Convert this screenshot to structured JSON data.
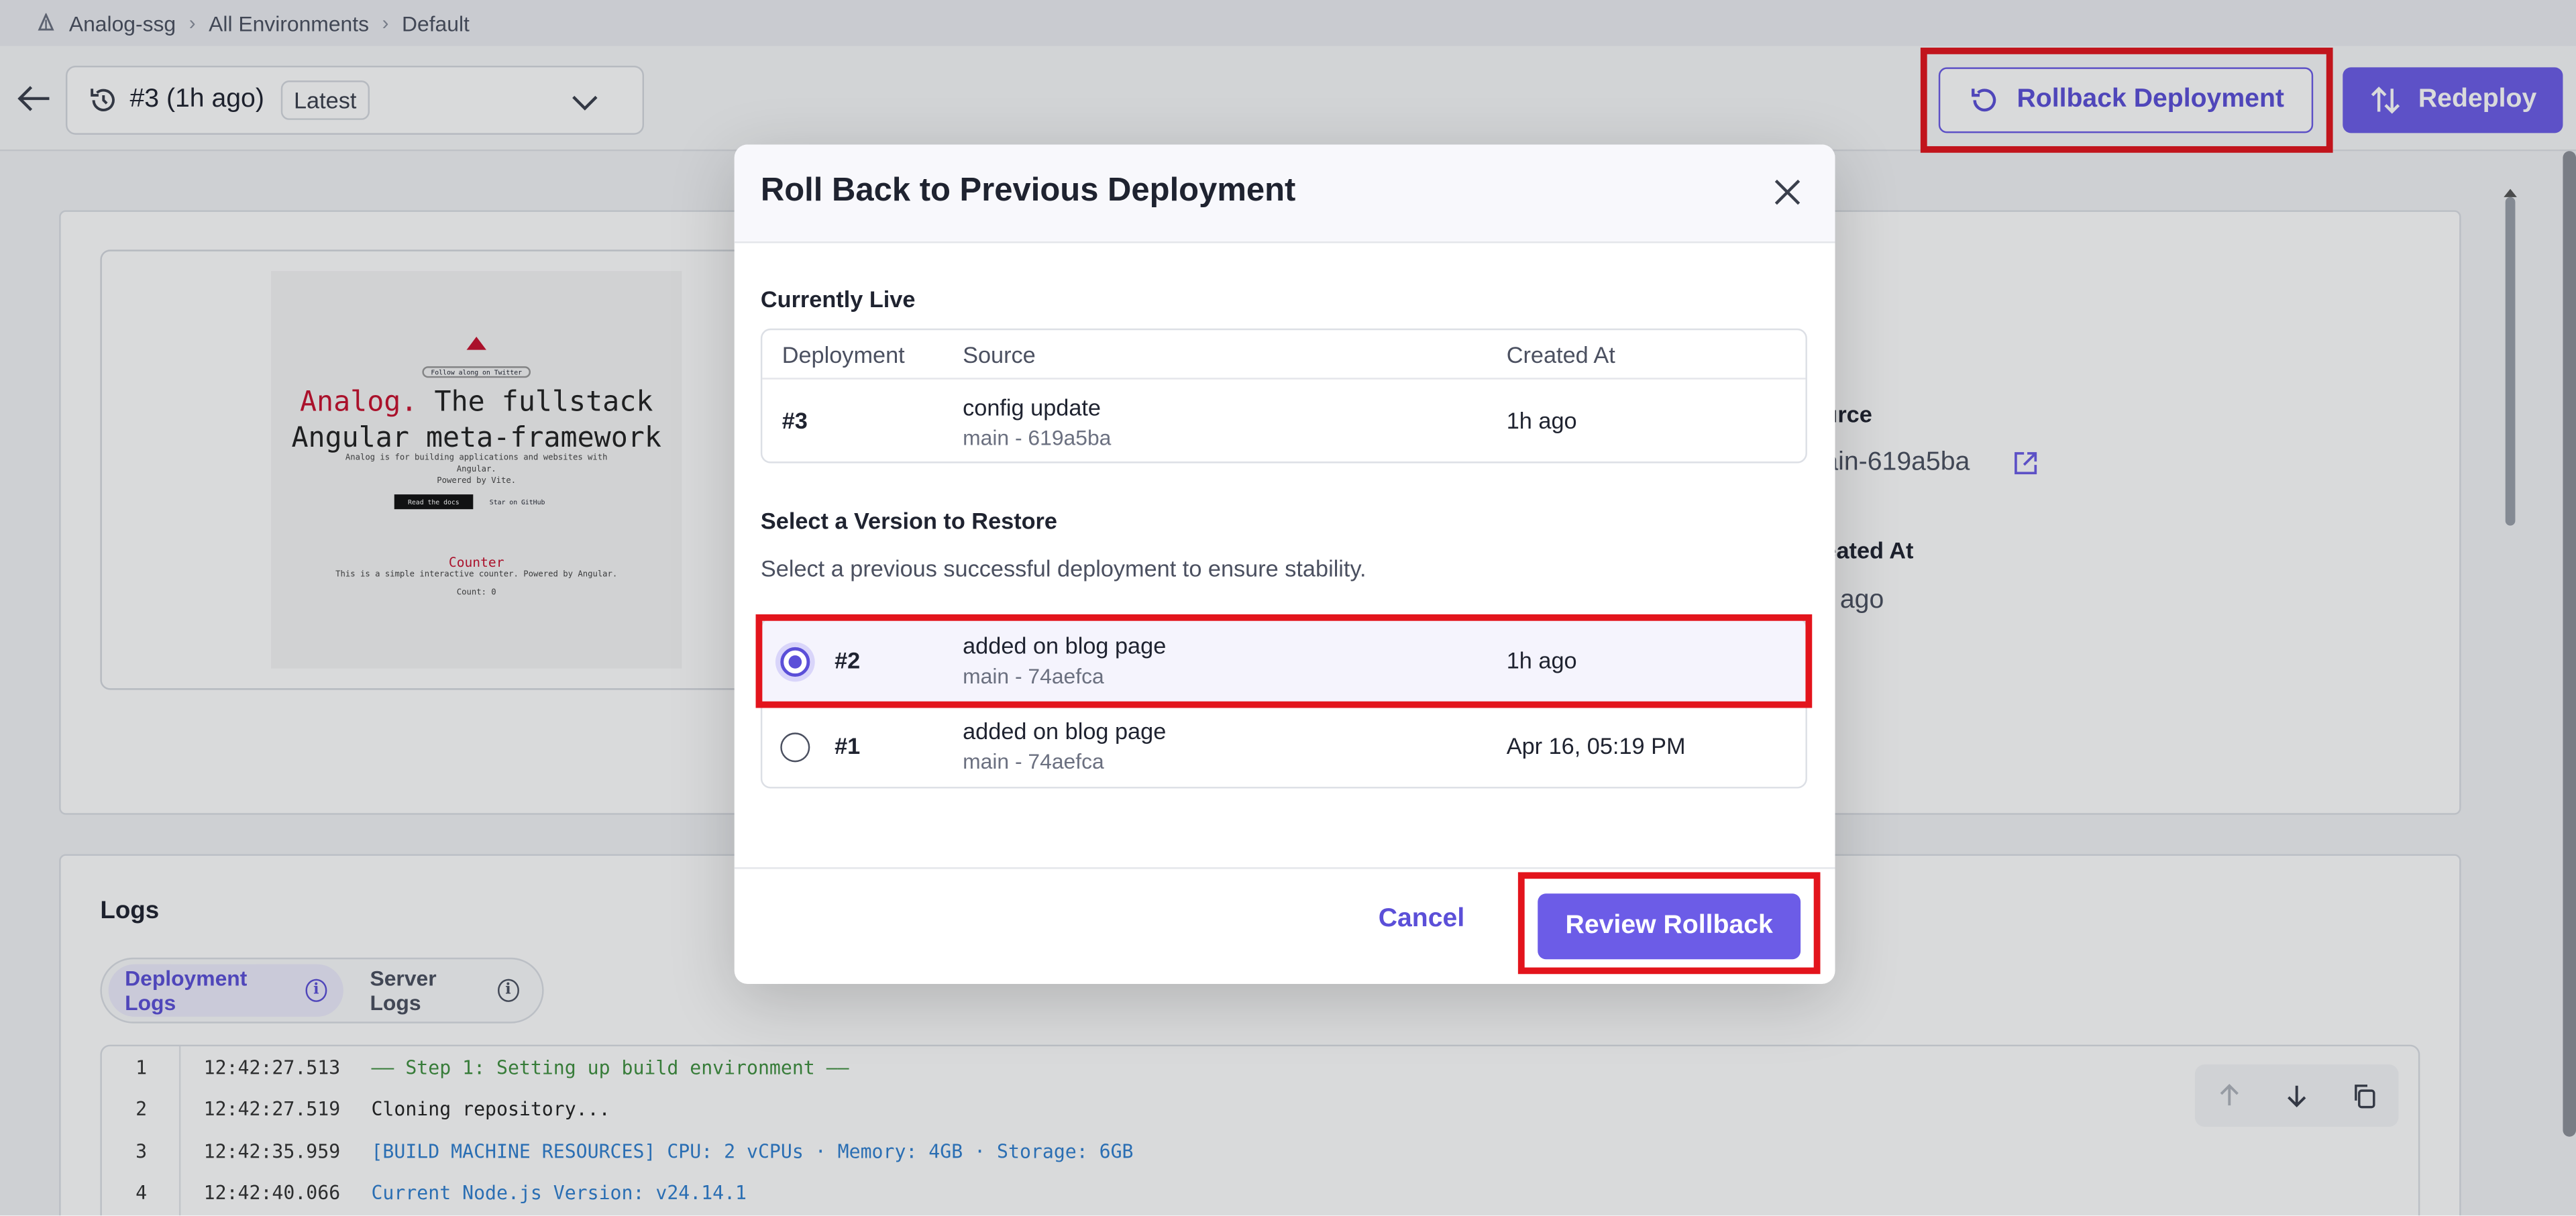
{
  "breadcrumb": {
    "items": [
      "Analog-ssg",
      "All Environments",
      "Default"
    ]
  },
  "header": {
    "deployment_label": "#3 (1h ago)",
    "deployment_badge": "Latest",
    "rollback_label": "Rollback Deployment",
    "redeploy_label": "Redeploy"
  },
  "preview": {
    "pill": "Follow along on Twitter",
    "heading_red": "Analog.",
    "heading_rest": " The fullstack",
    "heading_line2": "Angular meta-framework",
    "desc1": "Analog is for building applications and websites with",
    "desc2": "Angular.",
    "desc3": "Powered by Vite.",
    "btn_primary": "Read the docs",
    "btn_secondary": "Star on GitHub",
    "counter_title": "Counter",
    "counter_desc": "This is a simple interactive counter. Powered by Angular.",
    "counter_value": "Count: 0"
  },
  "details": {
    "source_label": "urce",
    "source_value": "ain-619a5ba",
    "created_label": "eated At",
    "created_value": "ago"
  },
  "logs": {
    "title": "Logs",
    "tabs": [
      "Deployment Logs",
      "Server Logs"
    ],
    "lines": [
      {
        "n": "1",
        "ts": "12:42:27.513",
        "msg": "—— Step 1: Setting up build environment ——",
        "color": "#3f8f3f"
      },
      {
        "n": "2",
        "ts": "12:42:27.519",
        "msg": "Cloning repository...",
        "color": "#222222"
      },
      {
        "n": "3",
        "ts": "12:42:35.959",
        "msg": "[BUILD MACHINE RESOURCES]  CPU: 2 vCPUs · Memory: 4GB · Storage: 6GB",
        "color": "#2f7fd0"
      },
      {
        "n": "4",
        "ts": "12:42:40.066",
        "msg": "Current Node.js Version: v24.14.1",
        "color": "#2f7fd0"
      }
    ]
  },
  "modal": {
    "title": "Roll Back to Previous Deployment",
    "currently_live": "Currently Live",
    "columns": [
      "Deployment",
      "Source",
      "Created At"
    ],
    "live": {
      "id": "#3",
      "title": "config update",
      "sub": "main - 619a5ba",
      "created": "1h ago"
    },
    "select_title": "Select a Version to Restore",
    "select_sub": "Select a previous successful deployment to ensure stability.",
    "versions": [
      {
        "id": "#2",
        "title": "added on blog page",
        "sub": "main - 74aefca",
        "created": "1h ago",
        "selected": true
      },
      {
        "id": "#1",
        "title": "added on blog page",
        "sub": "main - 74aefca",
        "created": "Apr 16, 05:19 PM",
        "selected": false
      }
    ],
    "cancel": "Cancel",
    "review": "Review Rollback"
  },
  "colors": {
    "accent": "#6c5ce7",
    "highlight": "#e3141c"
  }
}
